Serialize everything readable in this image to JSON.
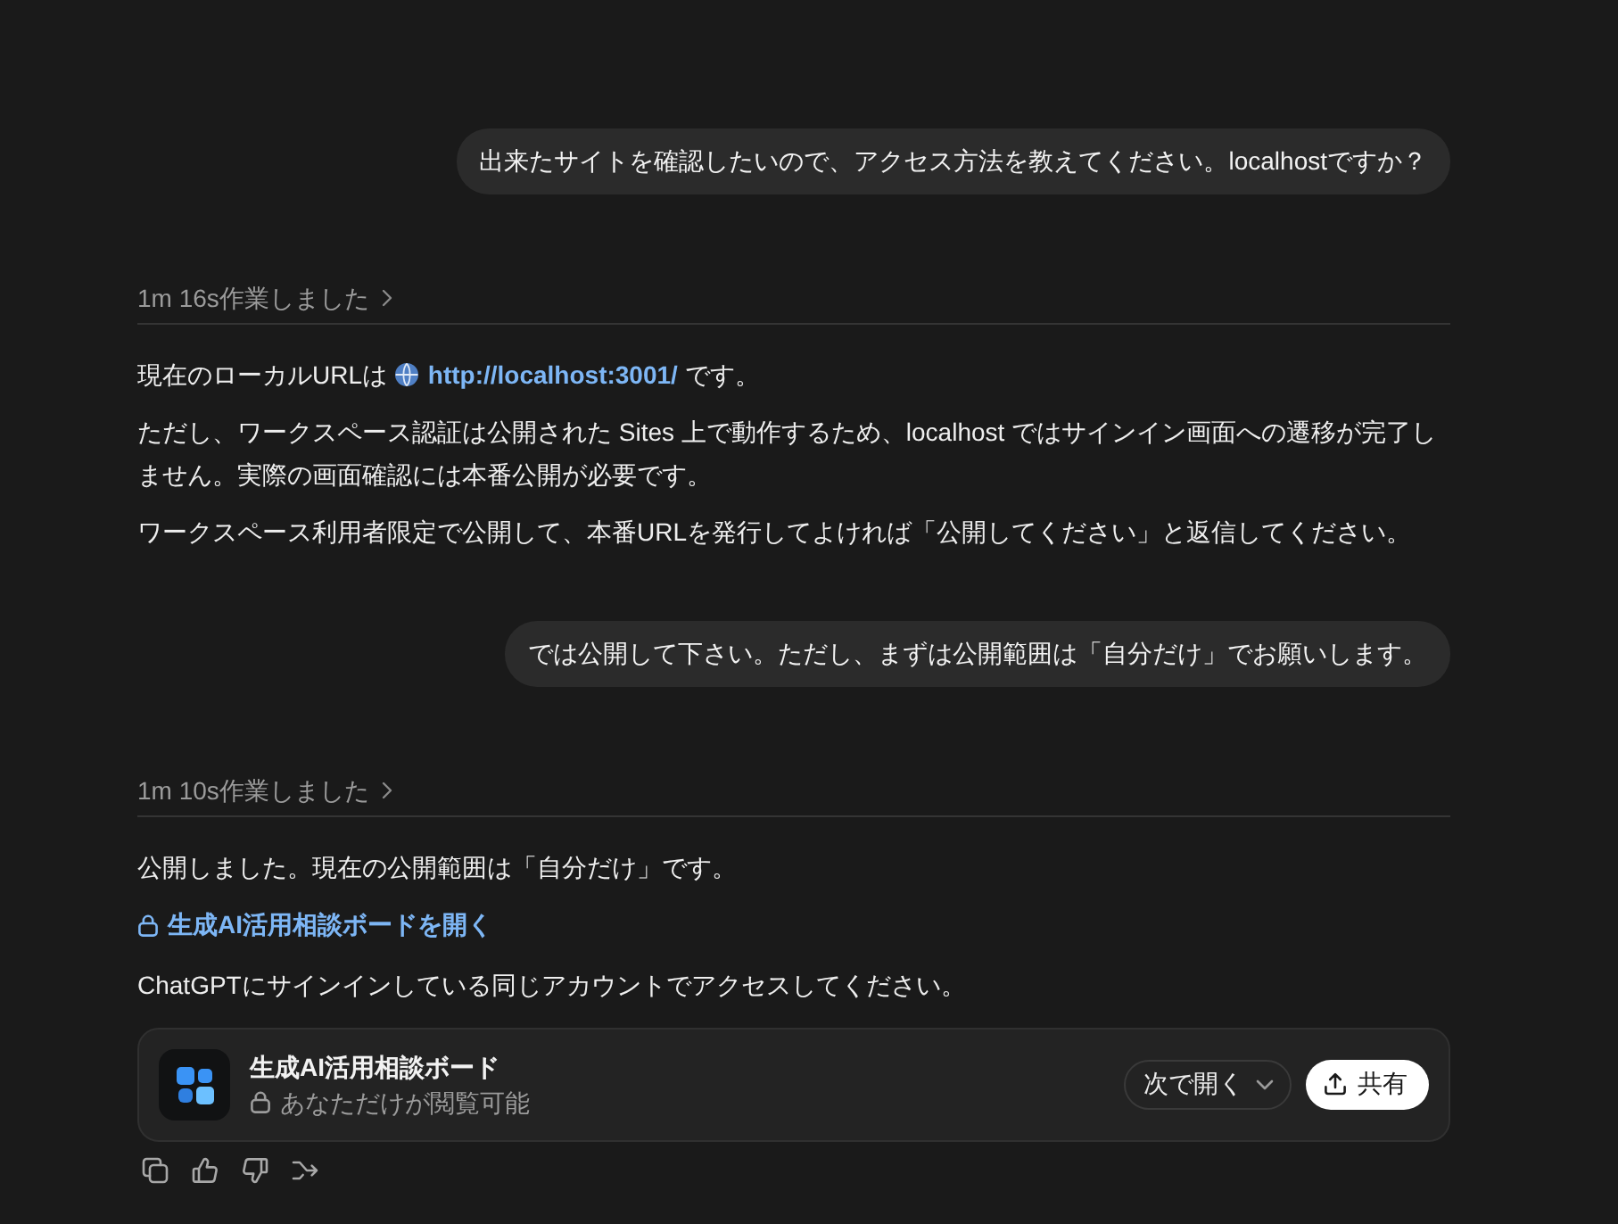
{
  "conversation": [
    {
      "kind": "user",
      "text": "出来たサイトを確認したいので、アクセス方法を教えてください。localhostですか？"
    },
    {
      "kind": "assistant",
      "thought_label": "1m 16s作業しました",
      "blocks": [
        {
          "kind": "url_line",
          "before": "現在のローカルURLは",
          "link": "http://localhost:3001/",
          "after": "です。"
        },
        {
          "kind": "paragraph",
          "text": "ただし、ワークスペース認証は公開された Sites 上で動作するため、localhost ではサインイン画面への遷移が完了しません。実際の画面確認には本番公開が必要です。"
        },
        {
          "kind": "paragraph",
          "text": "ワークスペース利用者限定で公開して、本番URLを発行してよければ「公開してください」と返信してください。"
        }
      ]
    },
    {
      "kind": "user",
      "text": "では公開して下さい。ただし、まずは公開範囲は「自分だけ」でお願いします。"
    },
    {
      "kind": "assistant",
      "thought_label": "1m 10s作業しました",
      "blocks": [
        {
          "kind": "paragraph",
          "text": "公開しました。現在の公開範囲は「自分だけ」です。"
        },
        {
          "kind": "lock_link",
          "text": "生成AI活用相談ボードを開く"
        },
        {
          "kind": "paragraph",
          "text": "ChatGPTにサインインしている同じアカウントでアクセスしてください。"
        },
        {
          "kind": "app_card",
          "title": "生成AI活用相談ボード",
          "subtitle": "あなただけが閲覧可能",
          "open_button": "次で開く",
          "share_button": "共有"
        }
      ],
      "actions": [
        {
          "kind": "copy"
        },
        {
          "kind": "like"
        },
        {
          "kind": "dislike"
        },
        {
          "kind": "branch"
        }
      ]
    }
  ]
}
